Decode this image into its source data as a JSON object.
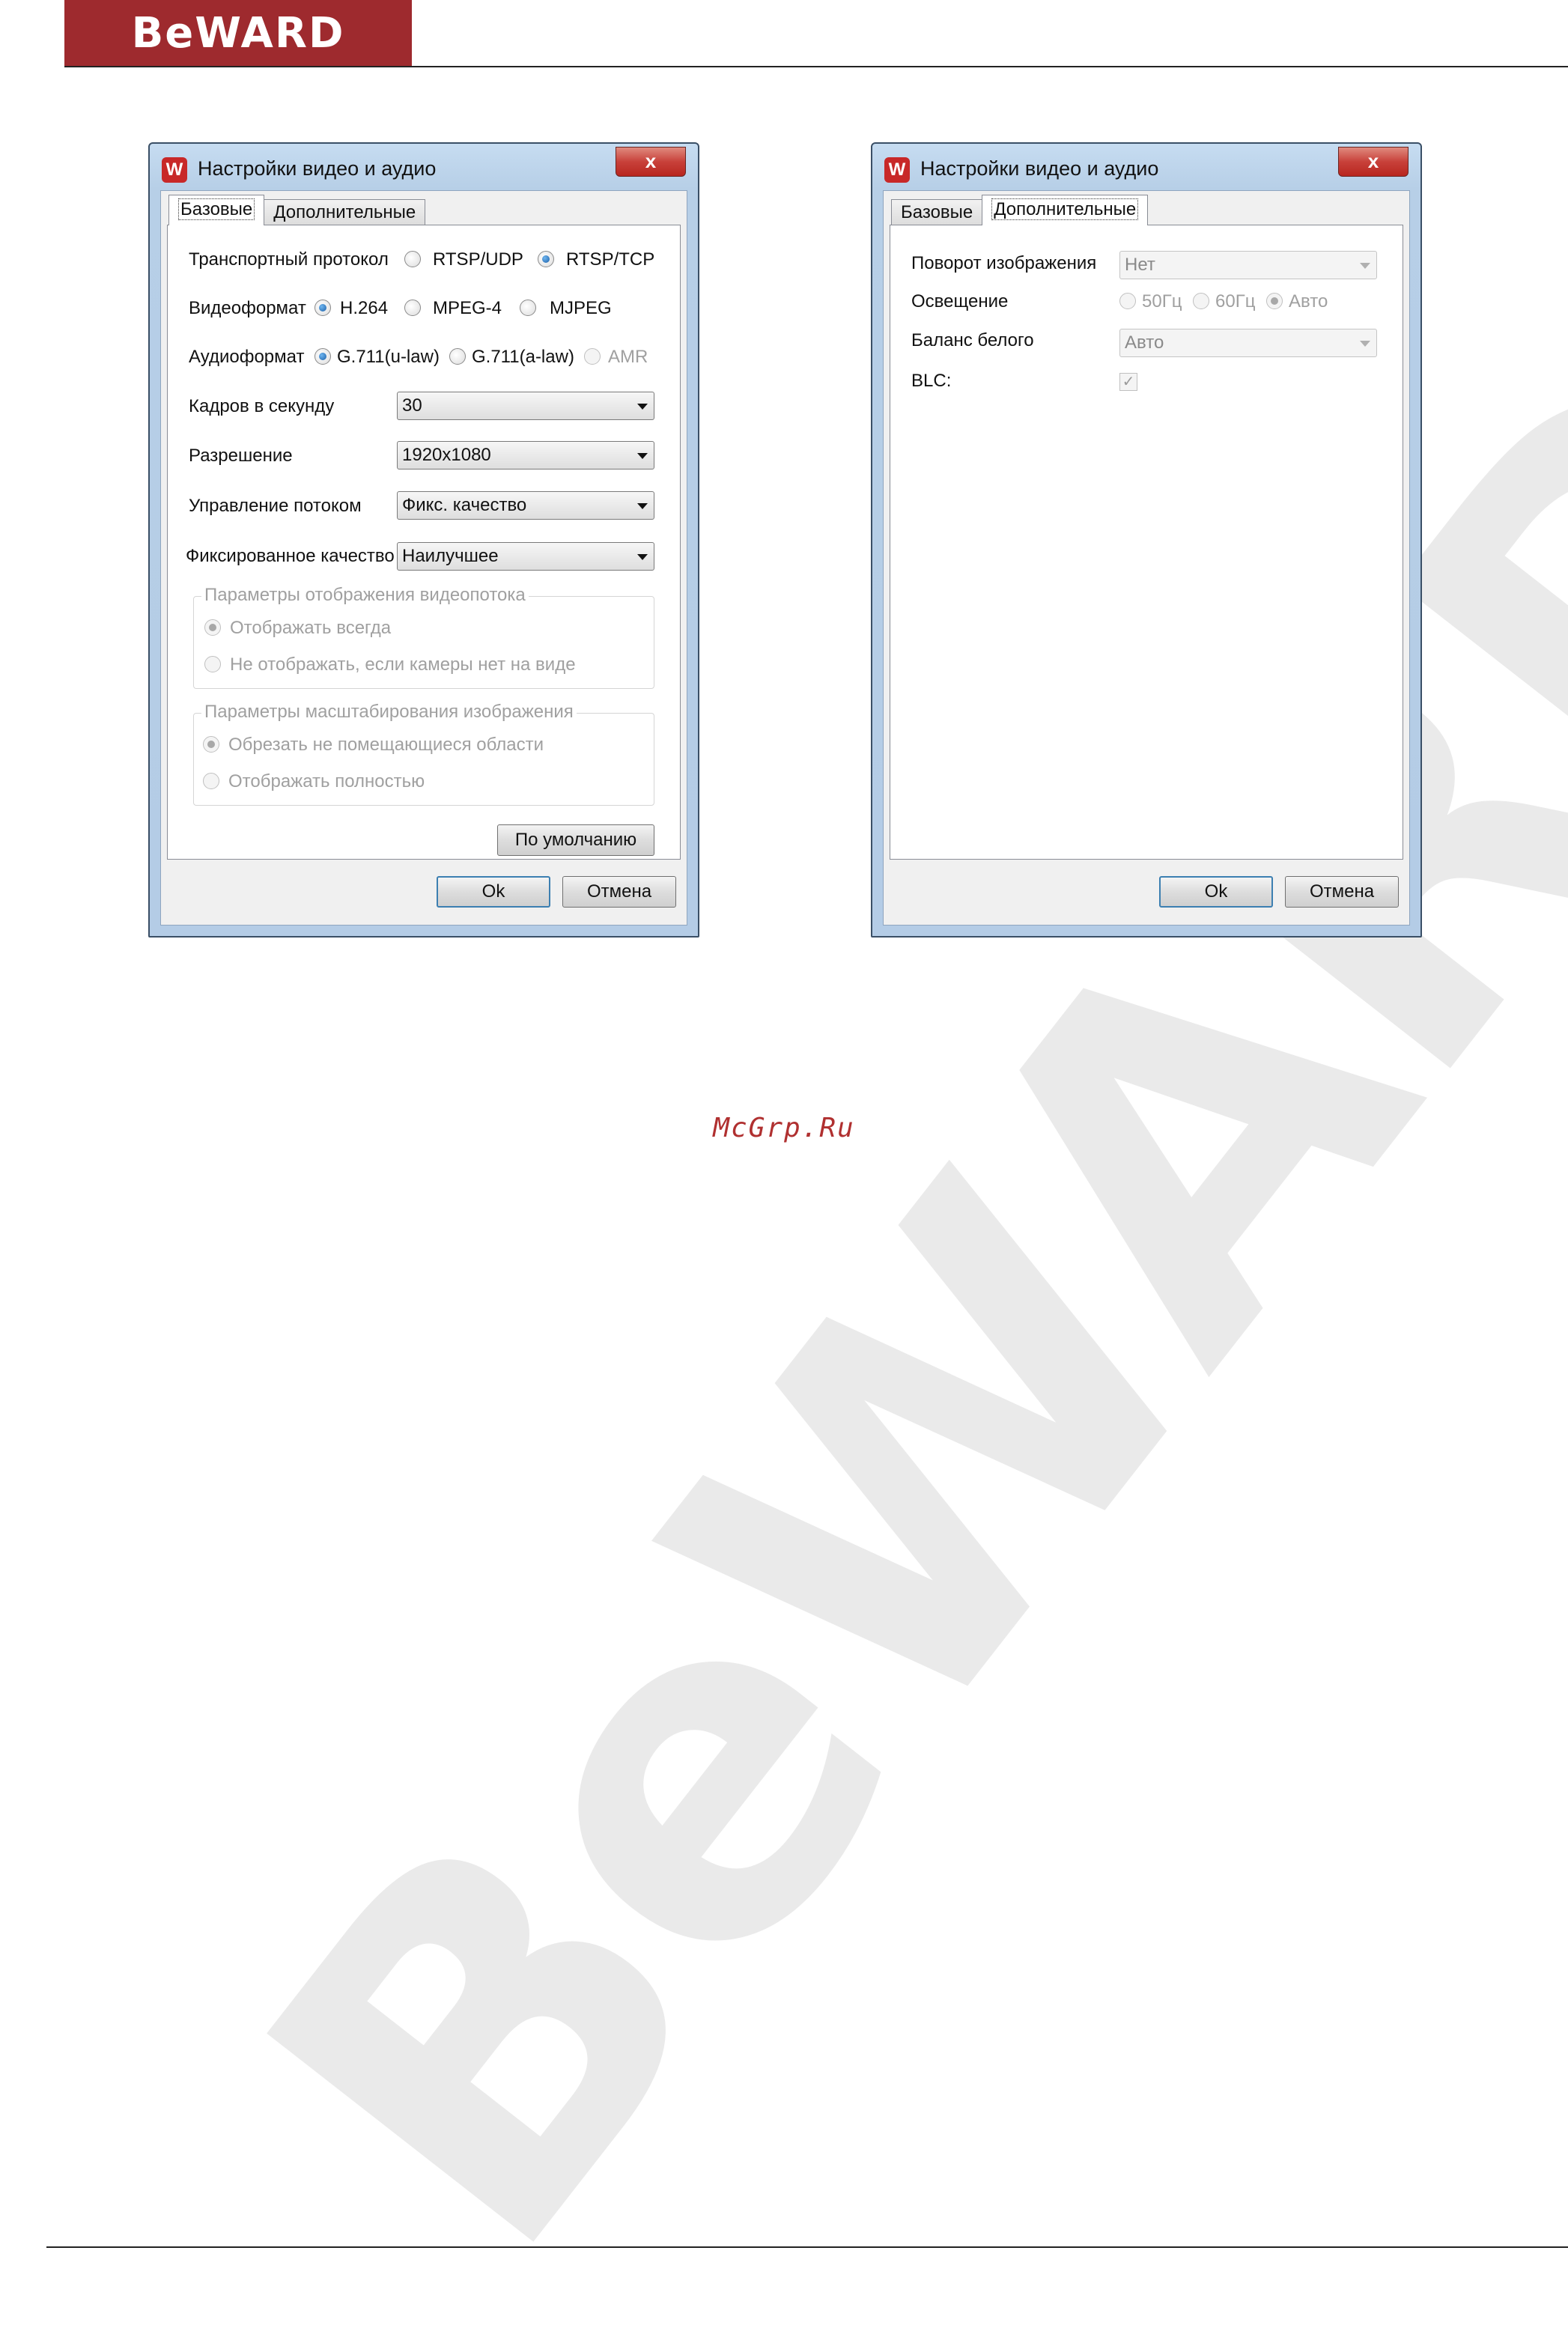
{
  "page": {
    "logo_text": "BeWARD",
    "site_mark": "McGrp.Ru",
    "watermark_text": "BeWARD"
  },
  "dialog_basic": {
    "title": "Настройки видео и аудио",
    "close_glyph": "x",
    "tabs": [
      {
        "label": "Базовые",
        "active": true
      },
      {
        "label": "Дополнительные",
        "active": false
      }
    ],
    "transport": {
      "label": "Транспортный протокол",
      "options": [
        {
          "label": "RTSP/UDP",
          "selected": false
        },
        {
          "label": "RTSP/TCP",
          "selected": true
        }
      ]
    },
    "video_format": {
      "label": "Видеоформат",
      "options": [
        {
          "label": "H.264",
          "selected": true
        },
        {
          "label": "MPEG-4",
          "selected": false
        },
        {
          "label": "MJPEG",
          "selected": false
        }
      ]
    },
    "audio_format": {
      "label": "Аудиоформат",
      "options": [
        {
          "label": "G.711(u-law)",
          "selected": true
        },
        {
          "label": "G.711(a-law)",
          "selected": false
        },
        {
          "label": "AMR",
          "selected": false,
          "disabled": true
        }
      ]
    },
    "fps": {
      "label": "Кадров в секунду",
      "value": "30"
    },
    "resolution": {
      "label": "Разрешение",
      "value": "1920x1080"
    },
    "bitrate_control": {
      "label": "Управление потоком",
      "value": "Фикс. качество"
    },
    "fixed_quality": {
      "label": "Фиксированное качество",
      "value": "Наилучшее"
    },
    "display_group": {
      "title": "Параметры отображения видеопотока",
      "options": [
        {
          "label": "Отображать всегда",
          "selected": true
        },
        {
          "label": "Не отображать, если камеры нет на виде",
          "selected": false
        }
      ]
    },
    "scale_group": {
      "title": "Параметры масштабирования изображения",
      "options": [
        {
          "label": "Обрезать не помещающиеся области",
          "selected": true
        },
        {
          "label": "Отображать полностью",
          "selected": false
        }
      ]
    },
    "defaults_button": "По умолчанию",
    "ok_button": "Ok",
    "cancel_button": "Отмена"
  },
  "dialog_advanced": {
    "title": "Настройки видео и аудио",
    "close_glyph": "x",
    "tabs": [
      {
        "label": "Базовые",
        "active": false
      },
      {
        "label": "Дополнительные",
        "active": true
      }
    ],
    "rotation": {
      "label": "Поворот изображения",
      "value": "Нет"
    },
    "lighting": {
      "label": "Освещение",
      "options": [
        {
          "label": "50Гц",
          "selected": false
        },
        {
          "label": "60Гц",
          "selected": false
        },
        {
          "label": "Авто",
          "selected": true
        }
      ]
    },
    "white_balance": {
      "label": "Баланс белого",
      "value": "Авто"
    },
    "blc": {
      "label": "BLC:",
      "checked": true,
      "check_glyph": "✓"
    },
    "ok_button": "Ok",
    "cancel_button": "Отмена"
  }
}
